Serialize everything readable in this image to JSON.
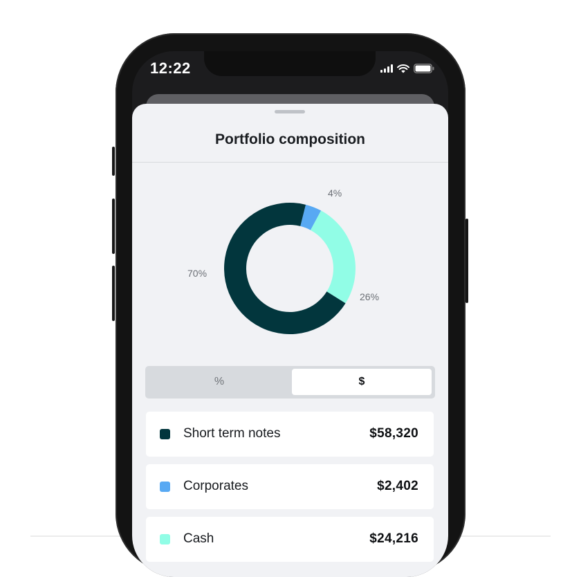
{
  "status_bar": {
    "time": "12:22"
  },
  "sheet": {
    "title": "Portfolio composition"
  },
  "chart_data": {
    "type": "pie",
    "variant": "donut",
    "categories": [
      "Short term notes",
      "Corporates",
      "Cash"
    ],
    "values": [
      70,
      4,
      26
    ],
    "labels": [
      "70%",
      "4%",
      "26%"
    ],
    "colors": [
      "#02363d",
      "#58a9f3",
      "#91fde6"
    ]
  },
  "toggle": {
    "options": [
      "%",
      "$"
    ],
    "selected": "$"
  },
  "holdings": [
    {
      "name": "Short term notes",
      "value": "$58,320",
      "color": "#02363d"
    },
    {
      "name": "Corporates",
      "value": "$2,402",
      "color": "#58a9f3"
    },
    {
      "name": "Cash",
      "value": "$24,216",
      "color": "#91fde6"
    }
  ]
}
